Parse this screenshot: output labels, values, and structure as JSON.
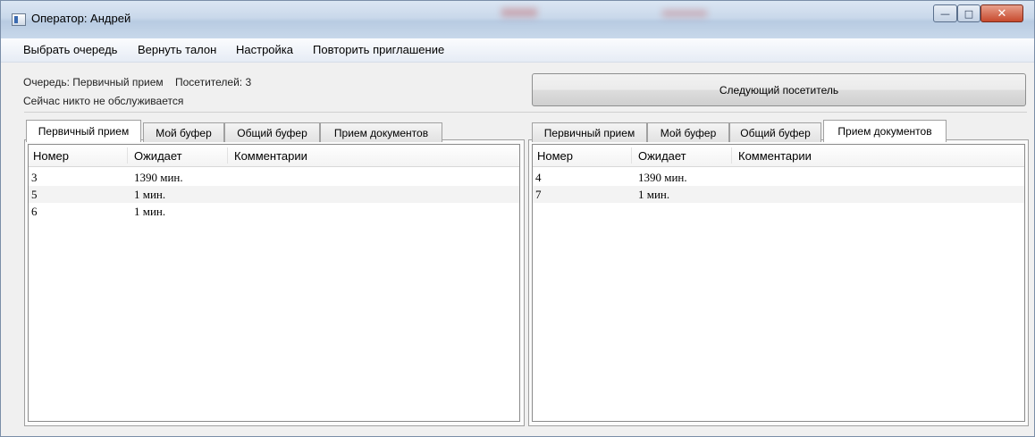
{
  "window": {
    "title": "Оператор: Андрей"
  },
  "menu": [
    "Выбрать очередь",
    "Вернуть талон",
    "Настройка",
    "Повторить приглашение"
  ],
  "status": {
    "queue_label": "Очередь: Первичный прием",
    "visitors_label": "Посетителей: 3",
    "serving_label": "Сейчас никто не обслуживается"
  },
  "next_button": "Следующий посетитель",
  "left_pane": {
    "tabs": [
      "Первичный прием",
      "Мой буфер",
      "Общий буфер",
      "Прием документов"
    ],
    "active_tab": "Первичный прием",
    "columns": [
      "Номер",
      "Ожидает",
      "Комментарии"
    ],
    "rows": [
      {
        "number": "3",
        "waiting": "1390 мин.",
        "comment": ""
      },
      {
        "number": "5",
        "waiting": "1 мин.",
        "comment": ""
      },
      {
        "number": "6",
        "waiting": "1 мин.",
        "comment": ""
      }
    ]
  },
  "right_pane": {
    "tabs": [
      "Первичный прием",
      "Мой буфер",
      "Общий буфер",
      "Прием документов"
    ],
    "active_tab": "Прием документов",
    "columns": [
      "Номер",
      "Ожидает",
      "Комментарии"
    ],
    "rows": [
      {
        "number": "4",
        "waiting": "1390 мин.",
        "comment": ""
      },
      {
        "number": "7",
        "waiting": "1 мин.",
        "comment": ""
      }
    ]
  }
}
